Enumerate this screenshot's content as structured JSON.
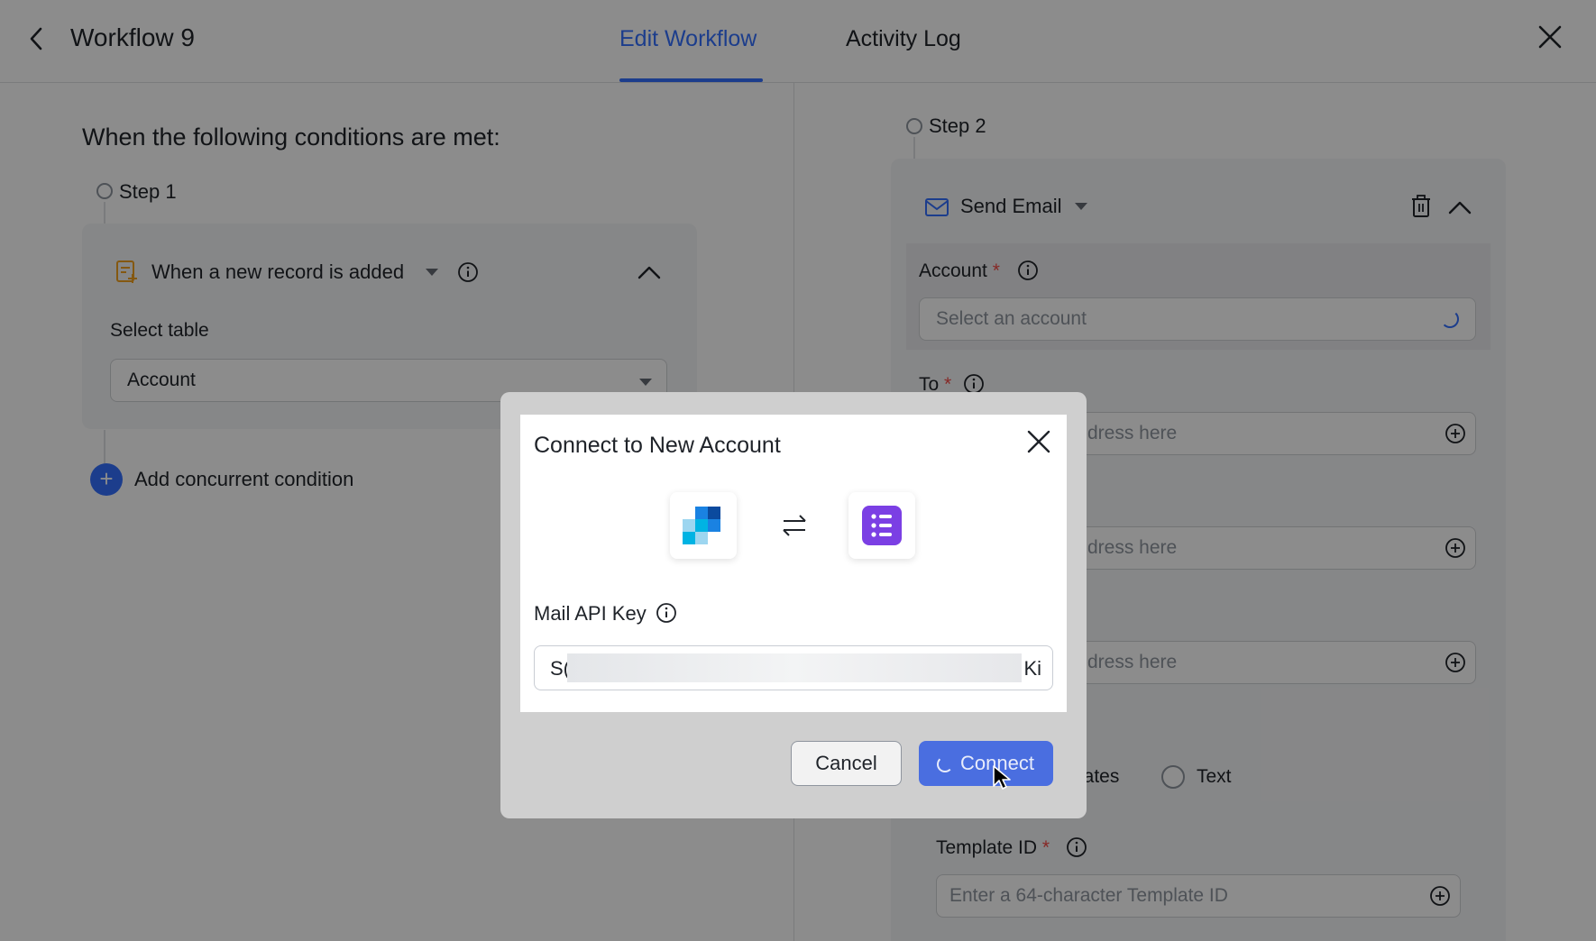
{
  "header": {
    "title": "Workflow 9",
    "tabs": [
      {
        "label": "Edit Workflow",
        "active": true
      },
      {
        "label": "Activity Log",
        "active": false
      }
    ]
  },
  "left": {
    "conditions_title": "When the following conditions are met:",
    "step_label": "Step 1",
    "trigger_label": "When a new record is added",
    "select_table_label": "Select table",
    "select_table_value": "Account",
    "add_condition_label": "Add concurrent condition"
  },
  "right": {
    "step_label": "Step 2",
    "action_label": "Send Email",
    "account_label": "Account",
    "account_placeholder": "Select an account",
    "to_label": "To",
    "address_placeholder_fragment": "dress here",
    "templates_fragment": "lates",
    "text_option": "Text",
    "template_id_label": "Template ID",
    "template_id_placeholder": "Enter a 64-character Template ID",
    "required_mark": "*"
  },
  "modal": {
    "title": "Connect to New Account",
    "api_key_label": "Mail API Key",
    "api_key_prefix": "S(",
    "api_key_suffix": "Ki",
    "cancel_label": "Cancel",
    "connect_label": "Connect"
  },
  "colors": {
    "accent": "#3370ff",
    "required": "#f54a45",
    "app_purple": "#7b3fe4"
  }
}
